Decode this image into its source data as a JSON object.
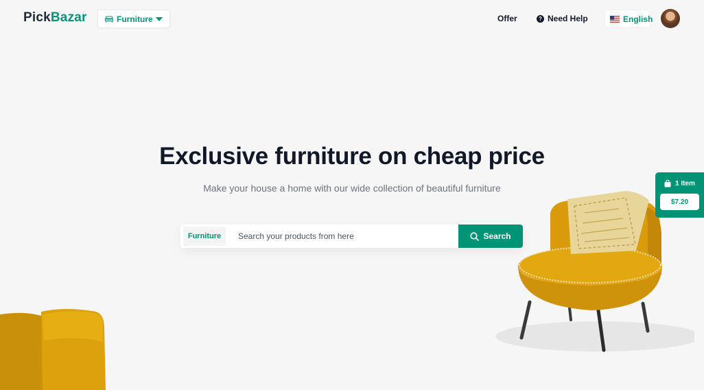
{
  "brand": {
    "part1": "Pick",
    "part2": "Bazar"
  },
  "group_select": {
    "label": "Furniture",
    "icon": "sofa-icon"
  },
  "nav": {
    "offer": "Offer",
    "help": "Need Help",
    "help_icon": "help-icon"
  },
  "language": {
    "label": "English",
    "icon": "us-flag-icon"
  },
  "hero": {
    "title": "Exclusive furniture on cheap price",
    "subtitle": "Make your house a home with our wide collection of beautiful furniture"
  },
  "search": {
    "category": "Furniture",
    "placeholder": "Search your products from here",
    "button_label": "Search"
  },
  "cart": {
    "count_label": "1 Item",
    "total": "$7.20"
  },
  "colors": {
    "accent": "#019376",
    "background": "#f6f6f6",
    "chair": "#e0a40e"
  }
}
